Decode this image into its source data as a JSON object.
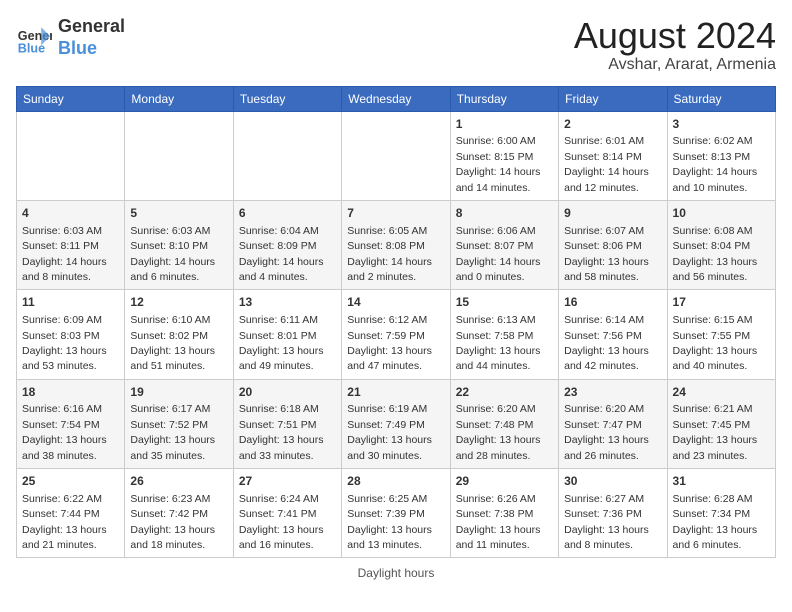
{
  "header": {
    "logo_line1": "General",
    "logo_line2": "Blue",
    "main_title": "August 2024",
    "subtitle": "Avshar, Ararat, Armenia"
  },
  "days_of_week": [
    "Sunday",
    "Monday",
    "Tuesday",
    "Wednesday",
    "Thursday",
    "Friday",
    "Saturday"
  ],
  "weeks": [
    {
      "cells": [
        {
          "day": "",
          "info": ""
        },
        {
          "day": "",
          "info": ""
        },
        {
          "day": "",
          "info": ""
        },
        {
          "day": "",
          "info": ""
        },
        {
          "day": "1",
          "info": "Sunrise: 6:00 AM\nSunset: 8:15 PM\nDaylight: 14 hours\nand 14 minutes."
        },
        {
          "day": "2",
          "info": "Sunrise: 6:01 AM\nSunset: 8:14 PM\nDaylight: 14 hours\nand 12 minutes."
        },
        {
          "day": "3",
          "info": "Sunrise: 6:02 AM\nSunset: 8:13 PM\nDaylight: 14 hours\nand 10 minutes."
        }
      ]
    },
    {
      "cells": [
        {
          "day": "4",
          "info": "Sunrise: 6:03 AM\nSunset: 8:11 PM\nDaylight: 14 hours\nand 8 minutes."
        },
        {
          "day": "5",
          "info": "Sunrise: 6:03 AM\nSunset: 8:10 PM\nDaylight: 14 hours\nand 6 minutes."
        },
        {
          "day": "6",
          "info": "Sunrise: 6:04 AM\nSunset: 8:09 PM\nDaylight: 14 hours\nand 4 minutes."
        },
        {
          "day": "7",
          "info": "Sunrise: 6:05 AM\nSunset: 8:08 PM\nDaylight: 14 hours\nand 2 minutes."
        },
        {
          "day": "8",
          "info": "Sunrise: 6:06 AM\nSunset: 8:07 PM\nDaylight: 14 hours\nand 0 minutes."
        },
        {
          "day": "9",
          "info": "Sunrise: 6:07 AM\nSunset: 8:06 PM\nDaylight: 13 hours\nand 58 minutes."
        },
        {
          "day": "10",
          "info": "Sunrise: 6:08 AM\nSunset: 8:04 PM\nDaylight: 13 hours\nand 56 minutes."
        }
      ]
    },
    {
      "cells": [
        {
          "day": "11",
          "info": "Sunrise: 6:09 AM\nSunset: 8:03 PM\nDaylight: 13 hours\nand 53 minutes."
        },
        {
          "day": "12",
          "info": "Sunrise: 6:10 AM\nSunset: 8:02 PM\nDaylight: 13 hours\nand 51 minutes."
        },
        {
          "day": "13",
          "info": "Sunrise: 6:11 AM\nSunset: 8:01 PM\nDaylight: 13 hours\nand 49 minutes."
        },
        {
          "day": "14",
          "info": "Sunrise: 6:12 AM\nSunset: 7:59 PM\nDaylight: 13 hours\nand 47 minutes."
        },
        {
          "day": "15",
          "info": "Sunrise: 6:13 AM\nSunset: 7:58 PM\nDaylight: 13 hours\nand 44 minutes."
        },
        {
          "day": "16",
          "info": "Sunrise: 6:14 AM\nSunset: 7:56 PM\nDaylight: 13 hours\nand 42 minutes."
        },
        {
          "day": "17",
          "info": "Sunrise: 6:15 AM\nSunset: 7:55 PM\nDaylight: 13 hours\nand 40 minutes."
        }
      ]
    },
    {
      "cells": [
        {
          "day": "18",
          "info": "Sunrise: 6:16 AM\nSunset: 7:54 PM\nDaylight: 13 hours\nand 38 minutes."
        },
        {
          "day": "19",
          "info": "Sunrise: 6:17 AM\nSunset: 7:52 PM\nDaylight: 13 hours\nand 35 minutes."
        },
        {
          "day": "20",
          "info": "Sunrise: 6:18 AM\nSunset: 7:51 PM\nDaylight: 13 hours\nand 33 minutes."
        },
        {
          "day": "21",
          "info": "Sunrise: 6:19 AM\nSunset: 7:49 PM\nDaylight: 13 hours\nand 30 minutes."
        },
        {
          "day": "22",
          "info": "Sunrise: 6:20 AM\nSunset: 7:48 PM\nDaylight: 13 hours\nand 28 minutes."
        },
        {
          "day": "23",
          "info": "Sunrise: 6:20 AM\nSunset: 7:47 PM\nDaylight: 13 hours\nand 26 minutes."
        },
        {
          "day": "24",
          "info": "Sunrise: 6:21 AM\nSunset: 7:45 PM\nDaylight: 13 hours\nand 23 minutes."
        }
      ]
    },
    {
      "cells": [
        {
          "day": "25",
          "info": "Sunrise: 6:22 AM\nSunset: 7:44 PM\nDaylight: 13 hours\nand 21 minutes."
        },
        {
          "day": "26",
          "info": "Sunrise: 6:23 AM\nSunset: 7:42 PM\nDaylight: 13 hours\nand 18 minutes."
        },
        {
          "day": "27",
          "info": "Sunrise: 6:24 AM\nSunset: 7:41 PM\nDaylight: 13 hours\nand 16 minutes."
        },
        {
          "day": "28",
          "info": "Sunrise: 6:25 AM\nSunset: 7:39 PM\nDaylight: 13 hours\nand 13 minutes."
        },
        {
          "day": "29",
          "info": "Sunrise: 6:26 AM\nSunset: 7:38 PM\nDaylight: 13 hours\nand 11 minutes."
        },
        {
          "day": "30",
          "info": "Sunrise: 6:27 AM\nSunset: 7:36 PM\nDaylight: 13 hours\nand 8 minutes."
        },
        {
          "day": "31",
          "info": "Sunrise: 6:28 AM\nSunset: 7:34 PM\nDaylight: 13 hours\nand 6 minutes."
        }
      ]
    }
  ],
  "footer": {
    "daylight_label": "Daylight hours"
  }
}
